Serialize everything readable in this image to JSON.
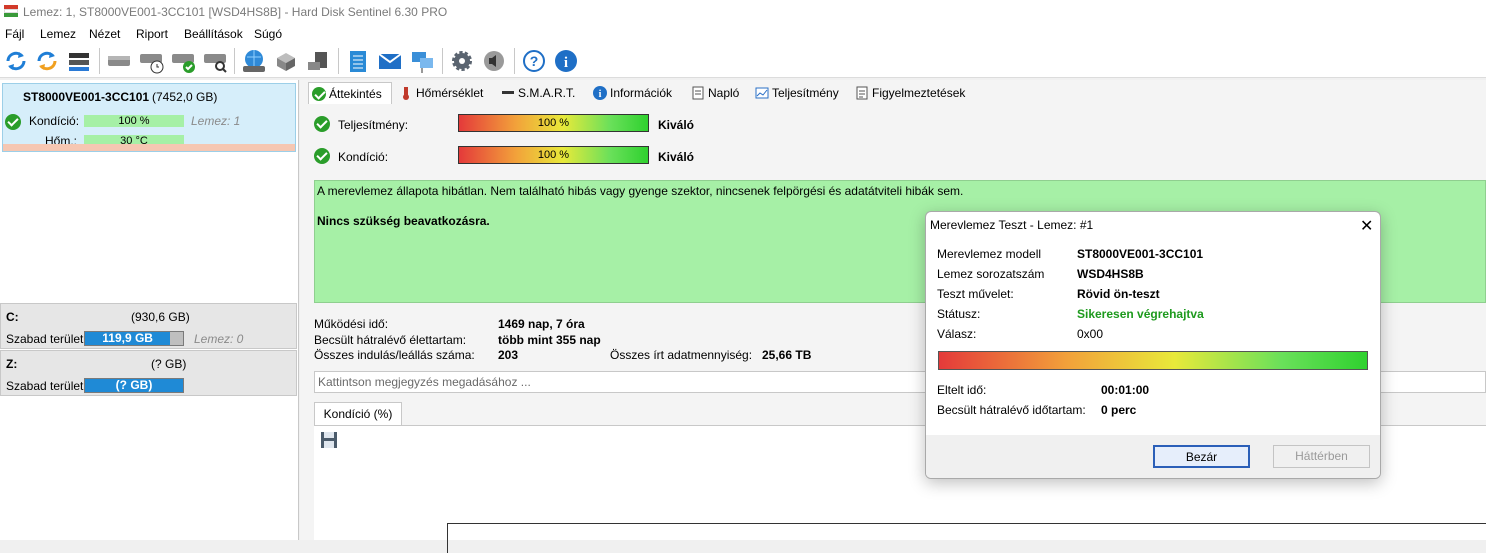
{
  "window": {
    "title": "Lemez: 1, ST8000VE001-3CC101 [WSD4HS8B]  -  Hard Disk Sentinel 6.30 PRO"
  },
  "menu": [
    "Fájl",
    "Lemez",
    "Nézet",
    "Riport",
    "Beállítások",
    "Súgó"
  ],
  "toolbar": {
    "icons": [
      "refresh-icon",
      "refresh-all-icon",
      "disk-list-icon",
      "disk-icon",
      "disk-clock-icon",
      "disk-check-icon",
      "disk-search-icon",
      "globe-disk-icon",
      "server-icon",
      "network-drive-icon",
      "notepad-icon",
      "mail-icon",
      "network-icon",
      "settings-gear-icon",
      "speaker-icon",
      "help-icon",
      "info-icon"
    ]
  },
  "disk": {
    "name": "ST8000VE001-3CC101",
    "size": "(7452,0 GB)",
    "health_label": "Kondíció:",
    "health_value": "100 %",
    "health_pct": 1.0,
    "disk_tag": "Lemez: 1",
    "temp_label": "Hőm.:",
    "temp_value": "30 °C"
  },
  "volumes": [
    {
      "name": "C:",
      "size": "(930,6 GB)",
      "free_label": "Szabad terület",
      "free_value": "119,9 GB",
      "free_pct": 0.87,
      "note": "Lemez: 0"
    },
    {
      "name": "Z:",
      "size": "(? GB)",
      "free_label": "Szabad terület",
      "free_value": "(? GB)",
      "free_pct": 1.0,
      "note": ""
    }
  ],
  "tabs": [
    "Áttekintés",
    "Hőmérséklet",
    "S.M.A.R.T.",
    "Információk",
    "Napló",
    "Teljesítmény",
    "Figyelmeztetések"
  ],
  "overview": {
    "perf_label": "Teljesítmény:",
    "perf_value": "100 %",
    "perf_rating": "Kiváló",
    "health_label": "Kondíció:",
    "health_value": "100 %",
    "health_rating": "Kiváló",
    "status_text": "A merevlemez állapota hibátlan. Nem található hibás vagy gyenge szektor, nincsenek felpörgési és adatátviteli hibák sem.",
    "action_text": "Nincs szükség beavatkozásra.",
    "uptime_label": "Működési idő:",
    "uptime_value": "1469 nap, 7 óra",
    "lifetime_label": "Becsült hátralévő élettartam:",
    "lifetime_value": "több mint 355 nap",
    "starts_label": "Összes indulás/leállás száma:",
    "starts_value": "203",
    "written_label": "Összes írt adatmennyiség:",
    "written_value": "25,66 TB",
    "comment_placeholder": "Kattintson megjegyzés megadásához ...",
    "chart_tab": "Kondíció  (%)"
  },
  "dialog": {
    "title": "Merevlemez Teszt - Lemez: #1",
    "rows": [
      {
        "label": "Merevlemez modell",
        "value": "ST8000VE001-3CC101"
      },
      {
        "label": "Lemez sorozatszám",
        "value": "WSD4HS8B"
      },
      {
        "label": "Teszt művelet:",
        "value": "Rövid ön-teszt"
      },
      {
        "label": "Státusz:",
        "value": "Sikeresen végrehajtva"
      },
      {
        "label": "Válasz:",
        "value": "0x00"
      }
    ],
    "progress": 1.0,
    "elapsed_label": "Eltelt idő:",
    "elapsed_value": "00:01:00",
    "remaining_label": "Becsült hátralévő időtartam:",
    "remaining_value": "0 perc",
    "close_button": "Bezár",
    "background_button": "Háttérben"
  }
}
